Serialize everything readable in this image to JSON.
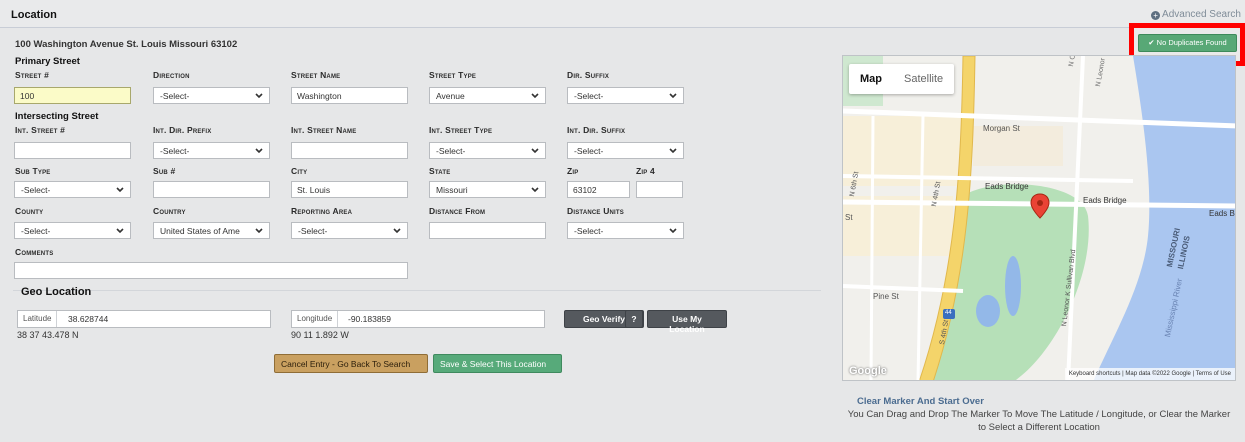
{
  "header": {
    "title": "Location",
    "advanced_search": "Advanced Search"
  },
  "address_line": "100 Washington Avenue St. Louis Missouri 63102",
  "primary": {
    "heading": "Primary Street",
    "labels": {
      "street_no": "Street #",
      "direction": "Direction",
      "street_name": "Street Name",
      "street_type": "Street Type",
      "dir_suffix": "Dir. Suffix"
    },
    "values": {
      "street_no": "100",
      "direction": "-Select-",
      "street_name": "Washington",
      "street_type": "Avenue",
      "dir_suffix": "-Select-"
    }
  },
  "intersecting": {
    "heading": "Intersecting Street",
    "labels": {
      "street_no": "Int. Street #",
      "dir_prefix": "Int. Dir. Prefix",
      "street_name": "Int. Street Name",
      "street_type": "Int. Street Type",
      "dir_suffix": "Int. Dir. Suffix"
    },
    "values": {
      "street_no": "",
      "dir_prefix": "-Select-",
      "street_name": "",
      "street_type": "-Select-",
      "dir_suffix": "-Select-"
    }
  },
  "row3": {
    "labels": {
      "sub_type": "Sub Type",
      "sub_no": "Sub #",
      "city": "City",
      "state": "State",
      "zip": "Zip",
      "zip4": "Zip 4"
    },
    "values": {
      "sub_type": "-Select-",
      "sub_no": "",
      "city": "St. Louis",
      "state": "Missouri",
      "zip": "63102",
      "zip4": ""
    }
  },
  "row4": {
    "labels": {
      "county": "County",
      "country": "Country",
      "reporting_area": "Reporting Area",
      "distance_from": "Distance From",
      "distance_units": "Distance Units"
    },
    "values": {
      "county": "-Select-",
      "country": "United States of Ame",
      "reporting_area": "-Select-",
      "distance_from": "",
      "distance_units": "-Select-"
    }
  },
  "comments": {
    "label": "Comments",
    "value": ""
  },
  "geo": {
    "title": "Geo Location",
    "latitude_label": "Latitude",
    "latitude": "38.628744",
    "latitude_dms": "38 37 43.478 N",
    "longitude_label": "Longitude",
    "longitude": "-90.183859",
    "longitude_dms": "90 11 1.892 W",
    "geo_verify": "Geo Verify",
    "help": "?",
    "use_my_location": "Use My Location"
  },
  "actions": {
    "cancel": "Cancel Entry - Go Back To Search",
    "save": "Save & Select This Location"
  },
  "duplicates": {
    "label": "No Duplicates Found"
  },
  "map": {
    "tab_map": "Map",
    "tab_satellite": "Satellite",
    "streets": {
      "n_comm": "N Comm",
      "n_leonor": "N Leonor K S",
      "morgan": "Morgan St",
      "n6th": "N 6th St",
      "n4th": "N 4th St",
      "eads1": "Eads Bridge",
      "eads2": "Eads Bridge",
      "eads3": "Eads B",
      "st": "St",
      "pine": "Pine St",
      "s4th": "S 4th St",
      "n_leonor2": "N Leonor K Sullivan Blvd",
      "missouri": "MISSOURI",
      "illinois": "ILLINOIS",
      "river": "Mississippi River",
      "route": "44"
    },
    "google": "Google",
    "footer": "Keyboard shortcuts | Map data ©2022 Google | Terms of Use"
  },
  "clear": {
    "title": "Clear Marker And Start Over",
    "desc": "You Can Drag and Drop The Marker To Move The Latitude / Longitude, or Clear the Marker to Select a Different Location"
  }
}
